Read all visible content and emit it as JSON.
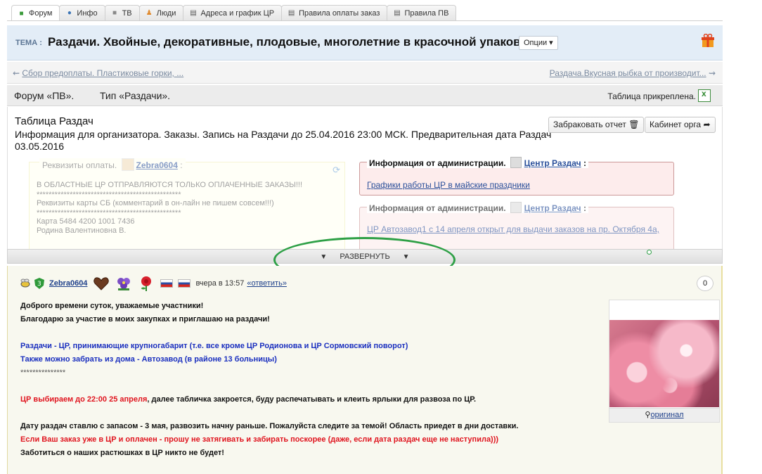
{
  "tabs": [
    {
      "label": "Форум",
      "icon": "chat-icon"
    },
    {
      "label": "Инфо",
      "icon": "info-icon"
    },
    {
      "label": "ТВ",
      "icon": "video-icon"
    },
    {
      "label": "Люди",
      "icon": "people-icon"
    },
    {
      "label": "Адреса и график ЦР",
      "icon": "document-icon"
    },
    {
      "label": "Правила оплаты заказ",
      "icon": "document-icon"
    },
    {
      "label": "Правила ПВ",
      "icon": "document-icon"
    }
  ],
  "topic": {
    "label": "ТЕМА :",
    "title": "Раздачи. Хвойные, декоративные, плодовые, многолетние в красочной упаковке.",
    "options_label": "Опции ▾"
  },
  "nav": {
    "prev": "Сбор предоплаты. Пластиковые горки, ...",
    "next": "Раздача.Вкусная рыбка от производит..."
  },
  "forum_type": {
    "forum": "Форум «ПВ».",
    "type": "Тип «Раздачи».",
    "attached": "Таблица прикреплена."
  },
  "table_panel": {
    "title": "Таблица Раздач",
    "description": "Информация для организатора. Заказы. Запись на Раздачи до 25.04.2016 23:00 МСК. Предварительная дата Раздач 03.05.2016",
    "reject_button": "Забраковать отчет",
    "cabinet_button": "Кабинет орга",
    "requisites": {
      "header": "Реквизиты оплаты.",
      "user": "Zebra0604",
      "lines": [
        "В ОБЛАСТНЫЕ ЦР ОТПРАВЛЯЮТСЯ ТОЛЬКО ОПЛАЧЕННЫЕ ЗАКАЗЫ!!!",
        "************************************************",
        "Реквизиты карты СБ (комментарий в он-лайн не пишем совсем!!!)",
        "************************************************",
        "Карта 5484 4200 1001 7436",
        "Родина Валентиновна В."
      ]
    },
    "admin_info": [
      {
        "header": "Информация от администрации.",
        "user": "Центр Раздач",
        "link": "Графики работы ЦР в майские праздники"
      },
      {
        "header": "Информация от администрации.",
        "user": "Центр Раздач",
        "link": "ЦР Автозавод1 с 14 апреля открыт для выдачи заказов на пр. Октября 4а,"
      }
    ]
  },
  "expand_label": "РАЗВЕРНУТЬ",
  "post": {
    "user": "Zebra0604",
    "time": "вчера в 13:57",
    "reply": "«ответить»",
    "counter": "0",
    "lines": [
      {
        "text": "Доброго времени суток, уважаемые участники!",
        "color": "black"
      },
      {
        "text": "Благодарю за участие в моих закупках и приглашаю на раздачи!",
        "color": "black"
      },
      {
        "text": "Раздачи - ЦР, принимающие крупногабарит (т.е. все кроме ЦР Родионова и ЦР Сормовский поворот)",
        "color": "blue"
      },
      {
        "text": "Также можно забрать из дома - Автозавод (в районе 13 больницы)",
        "color": "blue"
      },
      {
        "text": "***************",
        "color": "gray"
      },
      {
        "red": "ЦР выбираем до 22:00 25 апреля",
        "text": ", далее табличка закроется, буду распечатывать и клеить ярлыки для развоза по ЦР.",
        "color": "mixed"
      },
      {
        "text": "Дату раздач ставлю с запасом - 3 мая, развозить начну раньше. Пожалуйста следите за темой! Область приедет в дни доставки.",
        "color": "black"
      },
      {
        "text": "Если Ваш заказ уже в ЦР и оплачен - прошу не затягивать и забирать поскорее (даже, если дата раздач еще не наступила)))",
        "color": "red"
      },
      {
        "text": "Заботиться о наших растюшках в ЦР никто не будет!",
        "color": "black"
      }
    ],
    "image_caption": "оригинал"
  }
}
